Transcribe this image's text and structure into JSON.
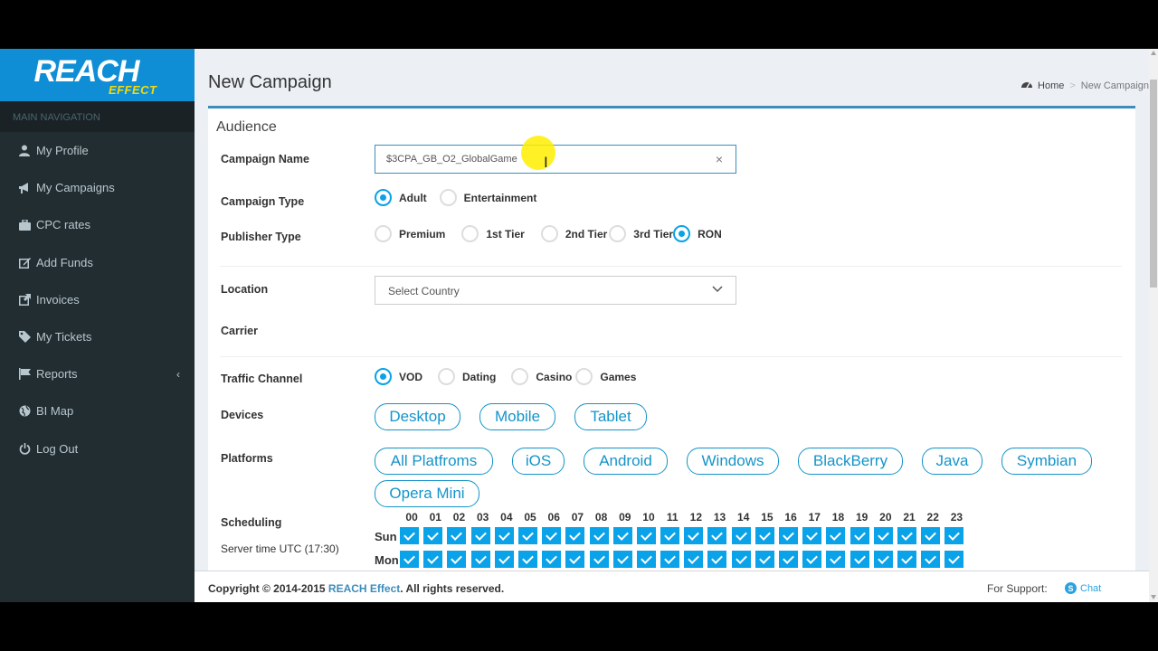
{
  "logo": {
    "main": "REACH",
    "sub": "EFFECT"
  },
  "sidebar": {
    "header": "MAIN NAVIGATION",
    "items": [
      {
        "label": "My Profile",
        "icon": "user-icon"
      },
      {
        "label": "My Campaigns",
        "icon": "bullhorn-icon"
      },
      {
        "label": "CPC rates",
        "icon": "briefcase-icon"
      },
      {
        "label": "Add Funds",
        "icon": "edit-icon"
      },
      {
        "label": "Invoices",
        "icon": "external-link-icon"
      },
      {
        "label": "My Tickets",
        "icon": "tag-icon"
      },
      {
        "label": "Reports",
        "icon": "flag-icon"
      },
      {
        "label": "BI Map",
        "icon": "globe-icon"
      },
      {
        "label": "Log Out",
        "icon": "power-icon"
      }
    ]
  },
  "header": {
    "title": "New Campaign",
    "breadcrumb": {
      "home": "Home",
      "current": "New Campaign"
    }
  },
  "form": {
    "section_title": "Audience",
    "campaign_name": {
      "label": "Campaign Name",
      "value": "$3CPA_GB_O2_GlobalGame"
    },
    "campaign_type": {
      "label": "Campaign Type",
      "options": [
        "Adult",
        "Entertainment"
      ],
      "selected": "Adult"
    },
    "publisher_type": {
      "label": "Publisher Type",
      "options": [
        "Premium",
        "1st Tier",
        "2nd Tier",
        "3rd Tier",
        "RON"
      ],
      "selected": "RON"
    },
    "location": {
      "label": "Location",
      "placeholder": "Select Country"
    },
    "carrier": {
      "label": "Carrier"
    },
    "traffic_channel": {
      "label": "Traffic Channel",
      "options": [
        "VOD",
        "Dating",
        "Casino",
        "Games"
      ],
      "selected": "VOD"
    },
    "devices": {
      "label": "Devices",
      "options": [
        "Desktop",
        "Mobile",
        "Tablet"
      ]
    },
    "platforms": {
      "label": "Platforms",
      "options": [
        "All Platfroms",
        "iOS",
        "Android",
        "Windows",
        "BlackBerry",
        "Java",
        "Symbian",
        "Opera Mini"
      ]
    },
    "scheduling": {
      "label": "Scheduling",
      "server_time": "Server time UTC (17:30)",
      "hours": [
        "00",
        "01",
        "02",
        "03",
        "04",
        "05",
        "06",
        "07",
        "08",
        "09",
        "10",
        "11",
        "12",
        "13",
        "14",
        "15",
        "16",
        "17",
        "18",
        "19",
        "20",
        "21",
        "22",
        "23"
      ],
      "days": [
        "Sun",
        "Mon"
      ]
    }
  },
  "footer": {
    "copyright_prefix": "Copyright © 2014-2015",
    "brand": "REACH Effect",
    "suffix": ". All rights reserved.",
    "support_label": "For Support:",
    "chat_label": "Chat"
  },
  "colors": {
    "sidebar": "#222d32",
    "logo_bg": "#0f8ed6",
    "accent": "#0aa2e8",
    "box_border": "#3c8dbc"
  }
}
